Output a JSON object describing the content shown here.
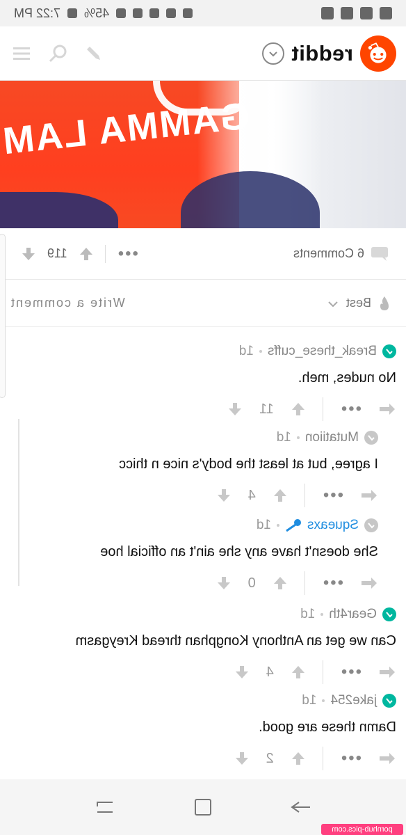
{
  "status_bar": {
    "time": "7:22 PM",
    "battery": "45%"
  },
  "app": {
    "brand": "reddit"
  },
  "post_actions": {
    "comments_label": "6 Comments",
    "score": "119"
  },
  "comment_bar": {
    "sort_label": "Best",
    "write_placeholder": "Write a comment"
  },
  "comments": [
    {
      "author": "Break_these_cuffs",
      "age": "1d",
      "body": "No nudes, meh.",
      "score": "11"
    },
    {
      "author": "Mutatiion",
      "age": "1d",
      "body": "I agree, but at least the body's nice n thicc",
      "score": "4"
    },
    {
      "author": "Squeaxs",
      "age": "1d",
      "body": "She doesn't have any she ain't an official hoe",
      "score": "0"
    },
    {
      "author": "Gear4th",
      "age": "1d",
      "body": "Can we get an Anthony Kongphan thread Kreygasm",
      "score": "4"
    },
    {
      "author": "jake254",
      "age": "1d",
      "body": "Damn these are good.",
      "score": "2"
    }
  ],
  "hero": {
    "shirt_text": "GAMMA LAM"
  },
  "watermark": "pornhub-pics.com"
}
